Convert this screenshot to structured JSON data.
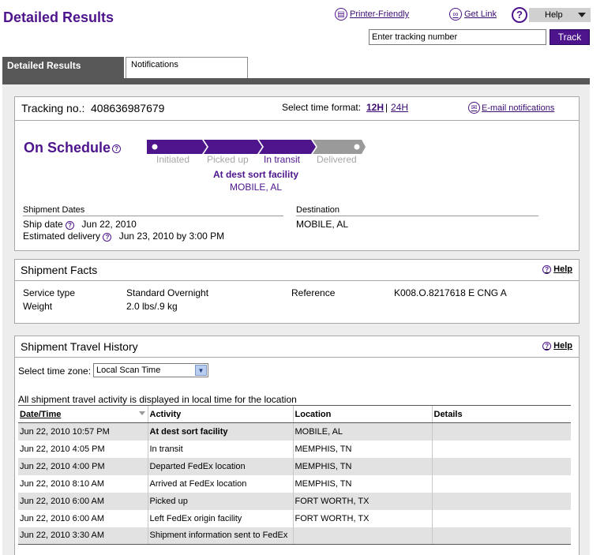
{
  "page_title": "Detailed Results",
  "header": {
    "printer_friendly": "Printer-Friendly",
    "get_link": "Get Link",
    "help_menu": "Help",
    "tracking_placeholder": "Enter tracking number",
    "track_button": "Track"
  },
  "tabs": [
    {
      "label": "Detailed Results",
      "active": true
    },
    {
      "label": "Notifications",
      "active": false
    }
  ],
  "summary": {
    "tracking_label": "Tracking no.:",
    "tracking_number": "408636987679",
    "time_format_label": "Select time format:",
    "format_12h": "12H",
    "format_separator": "|",
    "format_24h": "24H",
    "email_notifications": "E-mail notifications",
    "status": "On Schedule",
    "stages": [
      "Initiated",
      "Picked up",
      "In transit",
      "Delivered"
    ],
    "current_stage": 2,
    "current_event": "At dest sort facility",
    "current_location": "MOBILE, AL",
    "shipment_dates_label": "Shipment Dates",
    "ship_date_label": "Ship date",
    "ship_date": "Jun 22, 2010",
    "est_delivery_label": "Estimated delivery",
    "est_delivery": "Jun 23, 2010 by 3:00 PM",
    "destination_label": "Destination",
    "destination": "MOBILE, AL"
  },
  "facts": {
    "title": "Shipment Facts",
    "help": "Help",
    "service_type_label": "Service type",
    "service_type": "Standard Overnight",
    "weight_label": "Weight",
    "weight": "2.0 lbs/.9 kg",
    "reference_label": "Reference",
    "reference": "K008.O.8217618 E CNG A"
  },
  "history": {
    "title": "Shipment Travel History",
    "help": "Help",
    "timezone_label": "Select time zone:",
    "timezone_value": "Local Scan Time",
    "note": "All shipment travel activity is displayed in local time for the location",
    "columns": [
      "Date/Time",
      "Activity",
      "Location",
      "Details"
    ],
    "rows": [
      {
        "datetime": "Jun 22, 2010 10:57 PM",
        "activity": "At dest sort facility",
        "location": "MOBILE, AL",
        "details": ""
      },
      {
        "datetime": "Jun 22, 2010 4:05 PM",
        "activity": "In transit",
        "location": "MEMPHIS, TN",
        "details": ""
      },
      {
        "datetime": "Jun 22, 2010 4:00 PM",
        "activity": "Departed FedEx location",
        "location": "MEMPHIS, TN",
        "details": ""
      },
      {
        "datetime": "Jun 22, 2010 8:10 AM",
        "activity": "Arrived at FedEx location",
        "location": "MEMPHIS, TN",
        "details": ""
      },
      {
        "datetime": "Jun 22, 2010 6:00 AM",
        "activity": "Picked up",
        "location": "FORT WORTH, TX",
        "details": ""
      },
      {
        "datetime": "Jun 22, 2010 6:00 AM",
        "activity": "Left FedEx origin facility",
        "location": "FORT WORTH, TX",
        "details": ""
      },
      {
        "datetime": "Jun 22, 2010 3:30 AM",
        "activity": "Shipment information sent to FedEx",
        "location": "",
        "details": ""
      }
    ]
  }
}
